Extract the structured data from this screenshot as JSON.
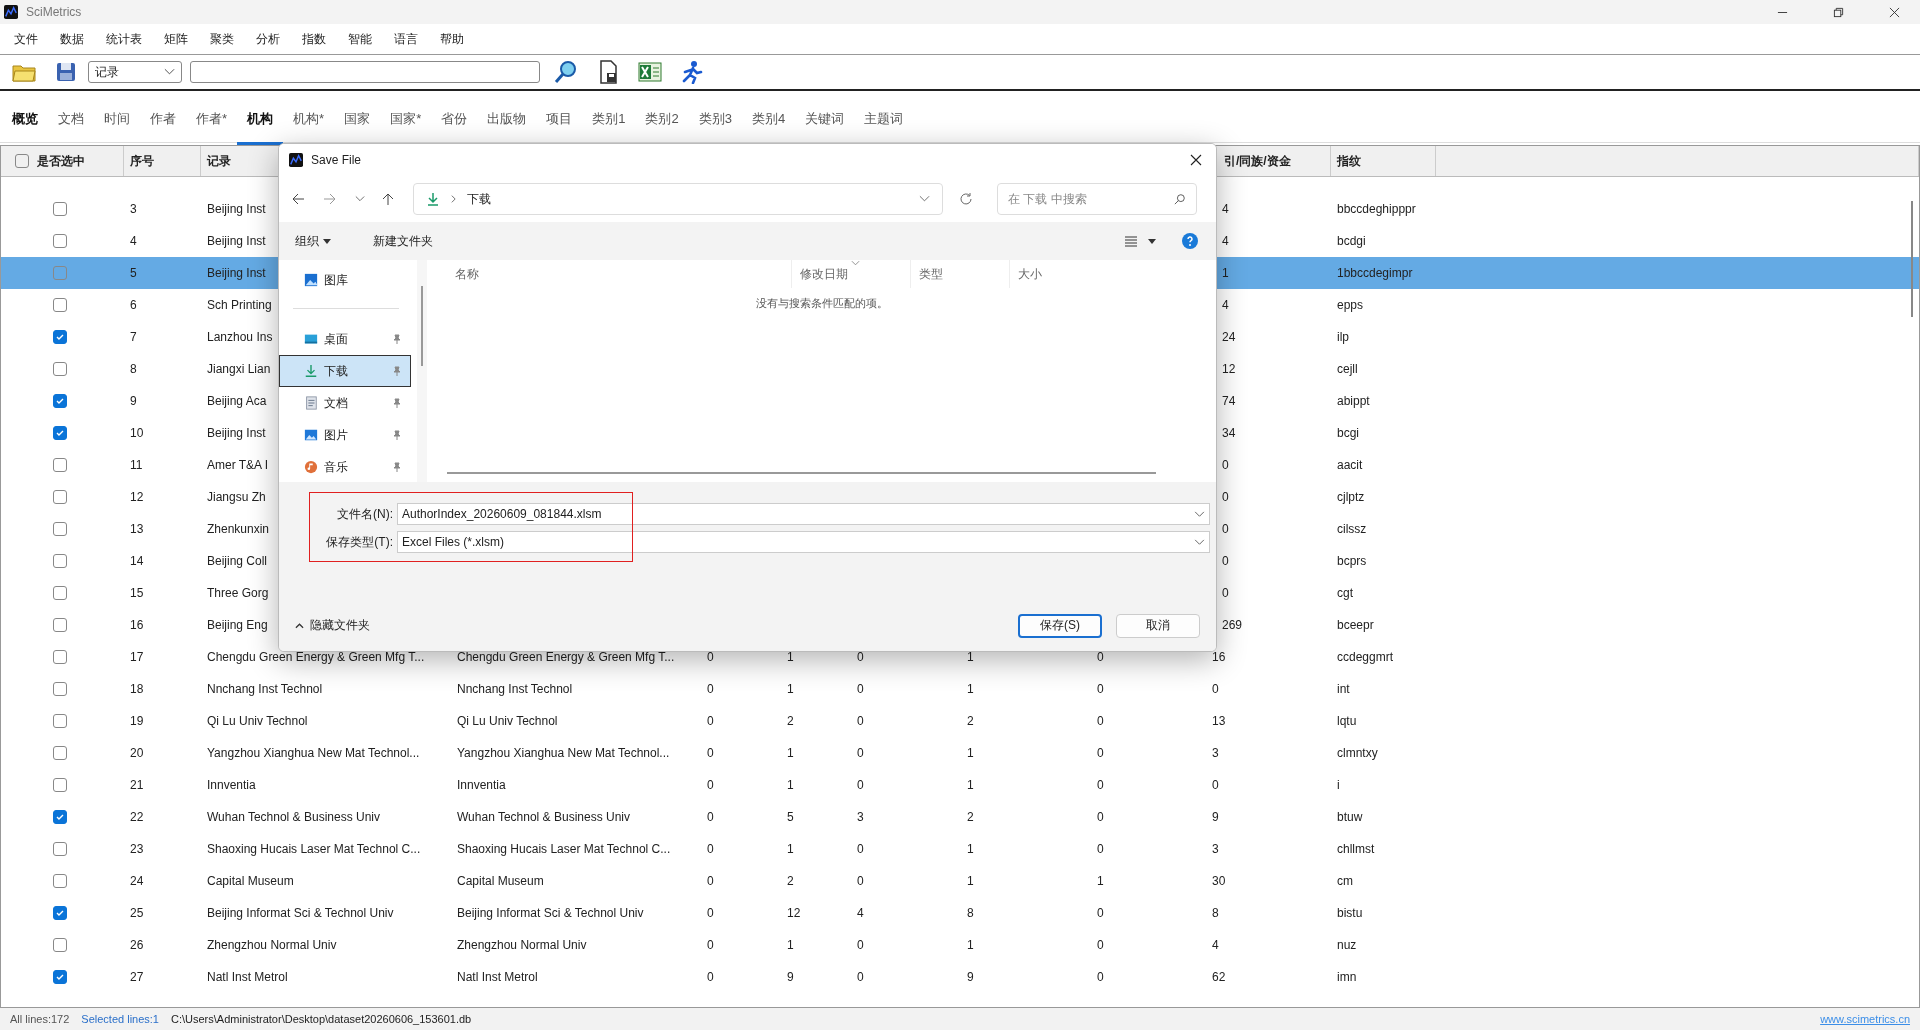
{
  "app": {
    "title": "SciMetrics"
  },
  "menu": [
    "文件",
    "数据",
    "统计表",
    "矩阵",
    "聚类",
    "分析",
    "指数",
    "智能",
    "语言",
    "帮助"
  ],
  "toolbar": {
    "record_type": "记录"
  },
  "tabs": [
    {
      "label": "概览",
      "selected": false
    },
    {
      "label": "文档",
      "selected": false
    },
    {
      "label": "时间",
      "selected": false
    },
    {
      "label": "作者",
      "selected": false
    },
    {
      "label": "作者*",
      "selected": false
    },
    {
      "label": "机构",
      "selected": true
    },
    {
      "label": "机构*",
      "selected": false
    },
    {
      "label": "国家",
      "selected": false
    },
    {
      "label": "国家*",
      "selected": false
    },
    {
      "label": "省份",
      "selected": false
    },
    {
      "label": "出版物",
      "selected": false
    },
    {
      "label": "项目",
      "selected": false
    },
    {
      "label": "类别1",
      "selected": false
    },
    {
      "label": "类别2",
      "selected": false
    },
    {
      "label": "类别3",
      "selected": false
    },
    {
      "label": "类别4",
      "selected": false
    },
    {
      "label": "关键词",
      "selected": false
    },
    {
      "label": "主题词",
      "selected": false
    }
  ],
  "table": {
    "select_all": {
      "label": "是否选中",
      "checked": false
    },
    "columns": {
      "number": "序号",
      "record": "记录",
      "column_9": "引/同族/资金",
      "fingerprint": "指纹"
    },
    "rows": [
      {
        "kind": "partial",
        "number": "3",
        "checked": false,
        "selected": false,
        "record": "Beijing Inst",
        "column_9": "4",
        "fingerprint": "bbccdeghipppr"
      },
      {
        "kind": "partial",
        "number": "4",
        "checked": false,
        "selected": false,
        "record": "Beijing Inst",
        "column_9": "4",
        "fingerprint": "bcdgi"
      },
      {
        "kind": "partial",
        "number": "5",
        "checked": false,
        "selected": true,
        "record": "Beijing Inst",
        "column_9": "1",
        "fingerprint": "1bbccdegimpr"
      },
      {
        "kind": "partial",
        "number": "6",
        "checked": false,
        "selected": false,
        "record": "Sch Printing",
        "column_9": "4",
        "fingerprint": "epps"
      },
      {
        "kind": "partial",
        "number": "7",
        "checked": true,
        "selected": false,
        "record": "Lanzhou Ins",
        "column_9": "24",
        "fingerprint": "ilp"
      },
      {
        "kind": "partial",
        "number": "8",
        "checked": false,
        "selected": false,
        "record": "Jiangxi Lian",
        "column_9": "12",
        "fingerprint": "cejll"
      },
      {
        "kind": "partial",
        "number": "9",
        "checked": true,
        "selected": false,
        "record": "Beijing Aca",
        "column_9": "74",
        "fingerprint": "abippt"
      },
      {
        "kind": "partial",
        "number": "10",
        "checked": true,
        "selected": false,
        "record": "Beijing Inst",
        "column_9": "34",
        "fingerprint": "bcgi"
      },
      {
        "kind": "partial",
        "number": "11",
        "checked": false,
        "selected": false,
        "record": "Amer T&A I",
        "column_9": "0",
        "fingerprint": "aacit"
      },
      {
        "kind": "partial",
        "number": "12",
        "checked": false,
        "selected": false,
        "record": "Jiangsu Zh",
        "column_9": "0",
        "fingerprint": "cjlptz"
      },
      {
        "kind": "partial",
        "number": "13",
        "checked": false,
        "selected": false,
        "record": "Zhenkunxin",
        "column_9": "0",
        "fingerprint": "cilssz"
      },
      {
        "kind": "partial",
        "number": "14",
        "checked": false,
        "selected": false,
        "record": "Beijing Coll",
        "column_9": "0",
        "fingerprint": "bcprs"
      },
      {
        "kind": "partial",
        "number": "15",
        "checked": false,
        "selected": false,
        "record": "Three Gorg",
        "column_9": "0",
        "fingerprint": "cgt"
      },
      {
        "kind": "partial",
        "number": "16",
        "checked": false,
        "selected": false,
        "record": "Beijing Eng",
        "column_9": "269",
        "fingerprint": "bceepr"
      },
      {
        "kind": "full",
        "number": "17",
        "checked": false,
        "selected": false,
        "record": "Chengdu Green Energy & Green Mfg T...",
        "column_3": "Chengdu Green Energy & Green Mfg T...",
        "values": [
          "0",
          "1",
          "0",
          "1",
          "0"
        ],
        "column_9": "16",
        "fingerprint": "ccdeggmrt"
      },
      {
        "kind": "full",
        "number": "18",
        "checked": false,
        "selected": false,
        "record": "Nnchang Inst Technol",
        "column_3": "Nnchang Inst Technol",
        "values": [
          "0",
          "1",
          "0",
          "1",
          "0"
        ],
        "column_9": "0",
        "fingerprint": "int"
      },
      {
        "kind": "full",
        "number": "19",
        "checked": false,
        "selected": false,
        "record": "Qi Lu Univ Technol",
        "column_3": "Qi Lu Univ Technol",
        "values": [
          "0",
          "2",
          "0",
          "2",
          "0"
        ],
        "column_9": "13",
        "fingerprint": "lqtu"
      },
      {
        "kind": "full",
        "number": "20",
        "checked": false,
        "selected": false,
        "record": "Yangzhou Xianghua New Mat Technol...",
        "column_3": "Yangzhou Xianghua New Mat Technol...",
        "values": [
          "0",
          "1",
          "0",
          "1",
          "0"
        ],
        "column_9": "3",
        "fingerprint": "clmntxy"
      },
      {
        "kind": "full",
        "number": "21",
        "checked": false,
        "selected": false,
        "record": "Innventia",
        "column_3": "Innventia",
        "values": [
          "0",
          "1",
          "0",
          "1",
          "0"
        ],
        "column_9": "0",
        "fingerprint": "i"
      },
      {
        "kind": "full",
        "number": "22",
        "checked": true,
        "selected": false,
        "record": "Wuhan Technol & Business Univ",
        "column_3": "Wuhan Technol & Business Univ",
        "values": [
          "0",
          "5",
          "3",
          "2",
          "0"
        ],
        "column_9": "9",
        "fingerprint": "btuw"
      },
      {
        "kind": "full",
        "number": "23",
        "checked": false,
        "selected": false,
        "record": "Shaoxing Hucais Laser Mat Technol C...",
        "column_3": "Shaoxing Hucais Laser Mat Technol C...",
        "values": [
          "0",
          "1",
          "0",
          "1",
          "0"
        ],
        "column_9": "3",
        "fingerprint": "chllmst"
      },
      {
        "kind": "full",
        "number": "24",
        "checked": false,
        "selected": false,
        "record": "Capital Museum",
        "column_3": "Capital Museum",
        "values": [
          "0",
          "2",
          "0",
          "1",
          "1"
        ],
        "column_9": "30",
        "fingerprint": "cm"
      },
      {
        "kind": "full",
        "number": "25",
        "checked": true,
        "selected": false,
        "record": "Beijing Informat Sci & Technol Univ",
        "column_3": "Beijing Informat Sci & Technol Univ",
        "values": [
          "0",
          "12",
          "4",
          "8",
          "0"
        ],
        "column_9": "8",
        "fingerprint": "bistu"
      },
      {
        "kind": "full",
        "number": "26",
        "checked": false,
        "selected": false,
        "record": "Zhengzhou Normal Univ",
        "column_3": "Zhengzhou Normal Univ",
        "values": [
          "0",
          "1",
          "0",
          "1",
          "0"
        ],
        "column_9": "4",
        "fingerprint": "nuz"
      },
      {
        "kind": "full",
        "number": "27",
        "checked": true,
        "selected": false,
        "record": "Natl Inst Metrol",
        "column_3": "Natl Inst Metrol",
        "values": [
          "0",
          "9",
          "0",
          "9",
          "0"
        ],
        "column_9": "62",
        "fingerprint": "imn"
      }
    ]
  },
  "status_bar": {
    "all_lines": "All lines:172",
    "selected_lines": "Selected lines:1",
    "path": "C:\\Users\\Administrator\\Desktop\\dataset20260606_153601.db",
    "link": "www.scimetrics.cn"
  },
  "dialog": {
    "title": "Save File",
    "address": "下载",
    "search_placeholder": "在 下载 中搜索",
    "commands": [
      "组织",
      "新建文件夹"
    ],
    "nav_groups": [
      {
        "items": [
          {
            "label": "图库",
            "kind": "library",
            "pinned": false,
            "selected": false
          }
        ]
      },
      {
        "items": [
          {
            "label": "桌面",
            "kind": "desktop",
            "pinned": true,
            "selected": false
          },
          {
            "label": "下载",
            "kind": "downloads",
            "pinned": true,
            "selected": true
          },
          {
            "label": "文档",
            "kind": "documents",
            "pinned": true,
            "selected": false
          },
          {
            "label": "图片",
            "kind": "pictures",
            "pinned": true,
            "selected": false
          },
          {
            "label": "音乐",
            "kind": "music",
            "pinned": true,
            "selected": false
          }
        ]
      }
    ],
    "columns": [
      "名称",
      "修改日期",
      "类型",
      "大小"
    ],
    "empty_message": "没有与搜索条件匹配的项。",
    "file_name": {
      "label": "文件名(N):",
      "value": "AuthorIndex_20260609_081844.xlsm"
    },
    "file_type": {
      "label": "保存类型(T):",
      "value": "Excel Files (*.xlsm)"
    },
    "hide_folders": "隐藏文件夹",
    "buttons": [
      {
        "label": "保存(S)",
        "kind": "primary"
      },
      {
        "label": "取消",
        "kind": "secondary"
      }
    ]
  }
}
